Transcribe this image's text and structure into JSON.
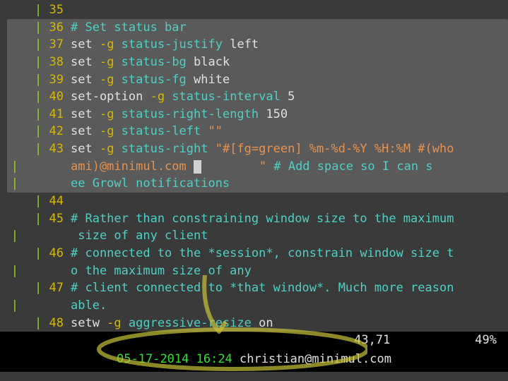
{
  "lines": {
    "l35_num": "35",
    "l36_num": "36",
    "l36_comment": "# Set status bar",
    "l37_num": "37",
    "l37_kw": "set",
    "l37_flag": " -g ",
    "l37_opt": "status-justify",
    "l37_val": " left",
    "l38_num": "38",
    "l38_kw": "set",
    "l38_flag": " -g ",
    "l38_opt": "status-bg",
    "l38_val": " black",
    "l39_num": "39",
    "l39_kw": "set",
    "l39_flag": " -g ",
    "l39_opt": "status-fg",
    "l39_val": " white",
    "l40_num": "40",
    "l40_kw": "set-option",
    "l40_flag": " -g ",
    "l40_opt": "status-interval",
    "l40_val": " 5",
    "l41_num": "41",
    "l41_kw": "set",
    "l41_flag": " -g ",
    "l41_opt": "status-right-length",
    "l41_val": " 150",
    "l42_num": "42",
    "l42_kw": "set",
    "l42_flag": " -g ",
    "l42_opt": "status-left",
    "l42_val": " \"\"",
    "l43_num": "43",
    "l43_kw": "set",
    "l43_flag": " -g ",
    "l43_opt": "status-right",
    "l43_str1": " \"#[fg=green] %m-%d-%Y %H:%M #(who",
    "l43_str2": "ami)@minimul.com ",
    "l43_str_end": "        \" ",
    "l43_comment": "# Add space so I can s",
    "l43_comment2": "ee Growl notifications",
    "l44_num": "44",
    "l45_num": "45",
    "l45_comment": "# Rather than constraining window size to the maximum",
    "l45_comment2": " size of any client",
    "l46_num": "46",
    "l46_comment": "# connected to the *session*, constrain window size t",
    "l46_comment2": "o the maximum size of any",
    "l47_num": "47",
    "l47_comment": "# client connected to *that window*. Much more reason",
    "l47_comment2": "able.",
    "l48_num": "48",
    "l48_kw": "setw",
    "l48_flag": " -g ",
    "l48_opt": "aggressive-resize",
    "l48_val": " on"
  },
  "ruler": {
    "pos": "43,71",
    "pct": "49%"
  },
  "status": {
    "date": "05-17-2014 16:24 ",
    "user": "christian@minimul.com"
  },
  "pipe": "|"
}
